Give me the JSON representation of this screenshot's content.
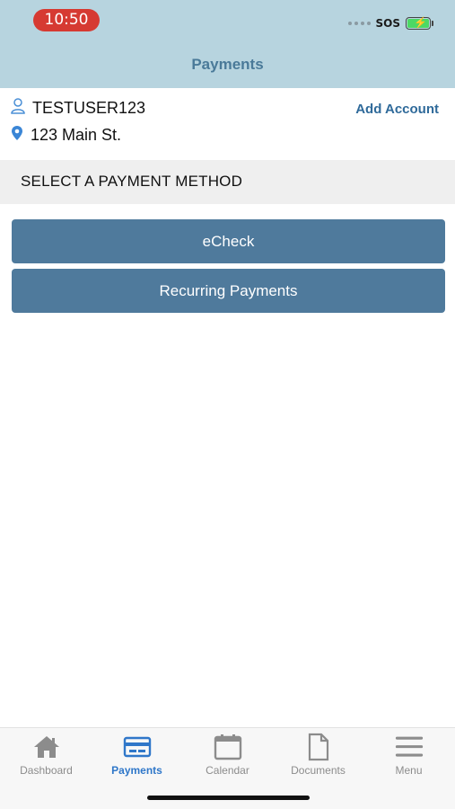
{
  "status_bar": {
    "time": "10:50",
    "carrier": "SOS"
  },
  "header": {
    "title": "Payments"
  },
  "account": {
    "username": "TESTUSER123",
    "address": "123 Main St.",
    "add_account_label": "Add Account"
  },
  "section": {
    "label": "SELECT A PAYMENT METHOD"
  },
  "payment_methods": [
    {
      "label": "eCheck"
    },
    {
      "label": "Recurring Payments"
    }
  ],
  "tabbar": {
    "active": "Payments",
    "items": [
      {
        "label": "Dashboard",
        "icon": "home-icon"
      },
      {
        "label": "Payments",
        "icon": "credit-card-icon"
      },
      {
        "label": "Calendar",
        "icon": "calendar-icon"
      },
      {
        "label": "Documents",
        "icon": "document-icon"
      },
      {
        "label": "Menu",
        "icon": "menu-icon"
      }
    ]
  },
  "colors": {
    "header_bg": "#b7d4df",
    "accent": "#2f77c9",
    "button_bg": "#4f7a9c",
    "time_pill": "#d63a32"
  }
}
